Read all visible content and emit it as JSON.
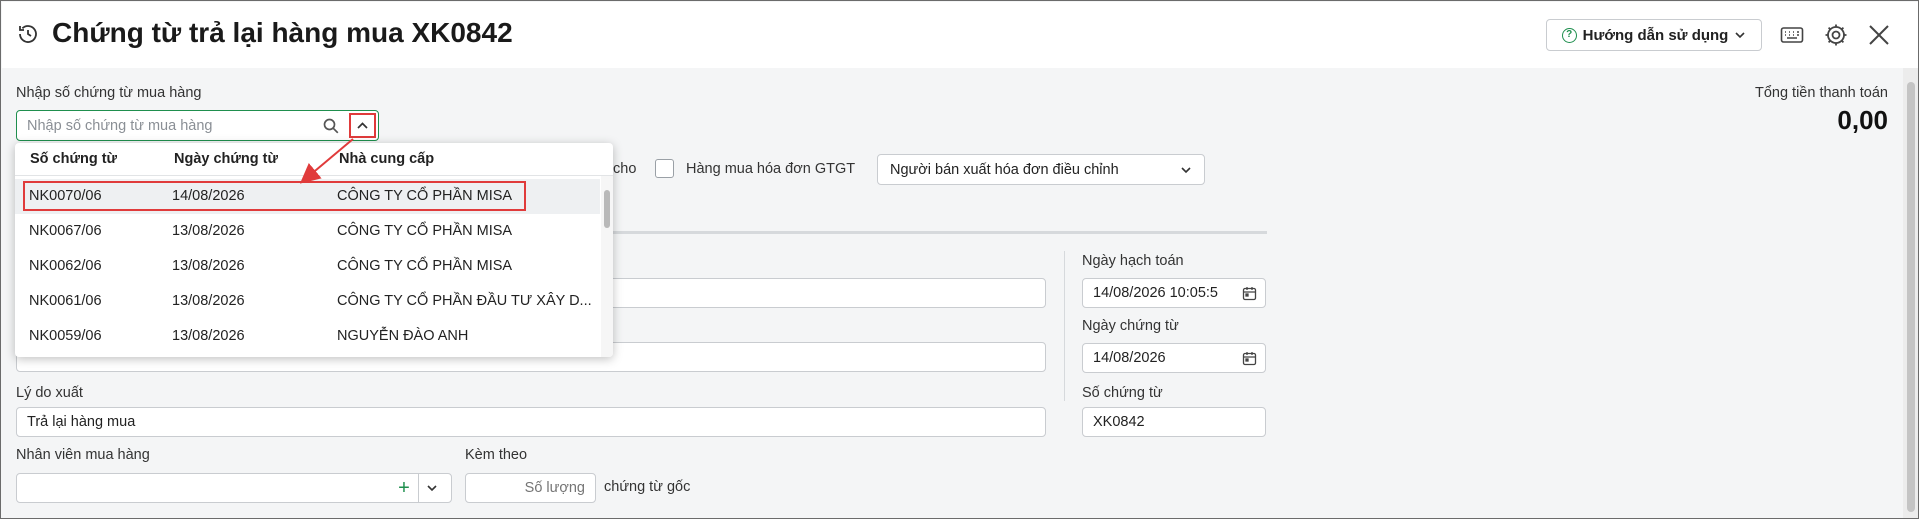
{
  "header": {
    "title": "Chứng từ trả lại hàng mua XK0842",
    "help_label": "Hướng dẫn sử dụng"
  },
  "search": {
    "label": "Nhập số chứng từ mua hàng",
    "placeholder": "Nhập số chứng từ mua hàng"
  },
  "total": {
    "label": "Tổng tiền thanh toán",
    "value": "0,00"
  },
  "options": {
    "checkbox1_label": "cho",
    "checkbox2_label": "Hàng mua hóa đơn GTGT",
    "invoice_select_value": "Người bán xuất hóa đơn điều chỉnh"
  },
  "dropdown": {
    "columns": [
      "Số chứng từ",
      "Ngày chứng từ",
      "Nhà cung cấp"
    ],
    "rows": [
      {
        "so": "NK0070/06",
        "ngay": "14/08/2026",
        "ncc": "CÔNG TY CỔ PHẦN MISA"
      },
      {
        "so": "NK0067/06",
        "ngay": "13/08/2026",
        "ncc": "CÔNG TY CỔ PHẦN MISA"
      },
      {
        "so": "NK0062/06",
        "ngay": "13/08/2026",
        "ncc": "CÔNG TY CỔ PHẦN MISA"
      },
      {
        "so": "NK0061/06",
        "ngay": "13/08/2026",
        "ncc": "CÔNG TY CỔ PHẦN ĐẦU TƯ XÂY D..."
      },
      {
        "so": "NK0059/06",
        "ngay": "13/08/2026",
        "ncc": "NGUYỄN ĐÀO ANH"
      }
    ]
  },
  "form": {
    "reason_label": "Lý do xuất",
    "reason_value": "Trả lại hàng mua",
    "buyer_label": "Nhân viên mua hàng",
    "attach_label": "Kèm theo",
    "attach_placeholder": "Số lượng",
    "attach_suffix": "chứng từ gốc",
    "posting_date_label": "Ngày hạch toán",
    "posting_date_value": "14/08/2026 10:05:5",
    "voucher_date_label": "Ngày chứng từ",
    "voucher_date_value": "14/08/2026",
    "voucher_no_label": "Số chứng từ",
    "voucher_no_value": "XK0842"
  },
  "colors": {
    "accent_green": "#1f8f4e",
    "highlight_red": "#e03b3b"
  }
}
